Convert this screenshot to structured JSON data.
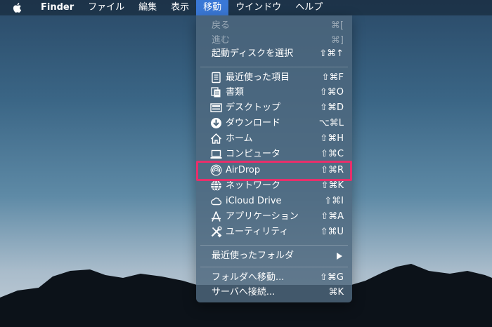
{
  "menubar": {
    "apple_icon": "apple-logo-icon",
    "app_name": "Finder",
    "items": [
      "ファイル",
      "編集",
      "表示",
      "移動",
      "ウインドウ",
      "ヘルプ"
    ],
    "active": "移動"
  },
  "menu": {
    "back": {
      "label": "戻る",
      "shortcut": "⌘["
    },
    "forward": {
      "label": "進む",
      "shortcut": "⌘]"
    },
    "startup": {
      "label": "起動ディスクを選択",
      "shortcut": "⇧⌘↑"
    },
    "recents": {
      "label": "最近使った項目",
      "shortcut": "⇧⌘F",
      "icon": "recents-icon"
    },
    "documents": {
      "label": "書類",
      "shortcut": "⇧⌘O",
      "icon": "documents-icon"
    },
    "desktop": {
      "label": "デスクトップ",
      "shortcut": "⇧⌘D",
      "icon": "desktop-icon"
    },
    "downloads": {
      "label": "ダウンロード",
      "shortcut": "⌥⌘L",
      "icon": "download-icon"
    },
    "home": {
      "label": "ホーム",
      "shortcut": "⇧⌘H",
      "icon": "home-icon"
    },
    "computer": {
      "label": "コンピュータ",
      "shortcut": "⇧⌘C",
      "icon": "computer-icon"
    },
    "airdrop": {
      "label": "AirDrop",
      "shortcut": "⇧⌘R",
      "icon": "airdrop-icon"
    },
    "network": {
      "label": "ネットワーク",
      "shortcut": "⇧⌘K",
      "icon": "network-icon"
    },
    "icloud": {
      "label": "iCloud Drive",
      "shortcut": "⇧⌘I",
      "icon": "cloud-icon"
    },
    "applications": {
      "label": "アプリケーション",
      "shortcut": "⇧⌘A",
      "icon": "applications-icon"
    },
    "utilities": {
      "label": "ユーティリティ",
      "shortcut": "⇧⌘U",
      "icon": "utilities-icon"
    },
    "recent_folders": {
      "label": "最近使ったフォルダ"
    },
    "goto_folder": {
      "label": "フォルダへ移動...",
      "shortcut": "⇧⌘G"
    },
    "connect_server": {
      "label": "サーバへ接続...",
      "shortcut": "⌘K"
    }
  },
  "colors": {
    "highlight": "#e72f6b",
    "active_menu": "#3a78d6"
  }
}
